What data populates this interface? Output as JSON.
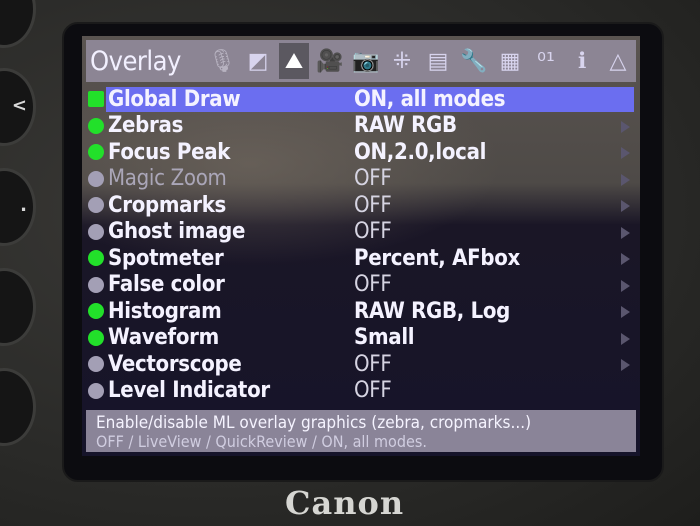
{
  "menu": {
    "title": "Overlay",
    "tabs": [
      {
        "icon": "audio-mic-icon",
        "glyph": "🎙",
        "state": "dim"
      },
      {
        "icon": "exposure-icon",
        "glyph": "◩",
        "state": "normal"
      },
      {
        "icon": "histogram-overlay-icon",
        "glyph": "⛰",
        "state": "active"
      },
      {
        "icon": "movie-camera-icon",
        "glyph": "🎥",
        "state": "normal"
      },
      {
        "icon": "photo-camera-icon",
        "glyph": "📷",
        "state": "normal"
      },
      {
        "icon": "focus-points-icon",
        "glyph": "⁜",
        "state": "normal"
      },
      {
        "icon": "display-settings-icon",
        "glyph": "▤",
        "state": "normal"
      },
      {
        "icon": "wrench-icon",
        "glyph": "🔧",
        "state": "normal"
      },
      {
        "icon": "modules-icon",
        "glyph": "▦",
        "state": "normal"
      },
      {
        "icon": "debug-binary-icon",
        "glyph": "⁰¹",
        "state": "normal"
      },
      {
        "icon": "info-icon",
        "glyph": "ℹ",
        "state": "normal"
      },
      {
        "icon": "delta-icon",
        "glyph": "△",
        "state": "normal"
      }
    ],
    "items": [
      {
        "label": "Global Draw",
        "value": "ON, all modes",
        "enabled": true,
        "selected": true,
        "dim": false,
        "indicator": "square"
      },
      {
        "label": "Zebras",
        "value": "RAW RGB",
        "enabled": true,
        "selected": false,
        "dim": false,
        "indicator": "round"
      },
      {
        "label": "Focus Peak",
        "value": "ON,2.0,local",
        "enabled": true,
        "selected": false,
        "dim": false,
        "indicator": "round"
      },
      {
        "label": "Magic Zoom",
        "value": "OFF",
        "enabled": false,
        "selected": false,
        "dim": true,
        "indicator": "round"
      },
      {
        "label": "Cropmarks",
        "value": "OFF",
        "enabled": false,
        "selected": false,
        "dim": false,
        "indicator": "round"
      },
      {
        "label": "Ghost image",
        "value": "OFF",
        "enabled": false,
        "selected": false,
        "dim": false,
        "indicator": "round"
      },
      {
        "label": "Spotmeter",
        "value": "Percent, AFbox",
        "enabled": true,
        "selected": false,
        "dim": false,
        "indicator": "round"
      },
      {
        "label": "False color",
        "value": "OFF",
        "enabled": false,
        "selected": false,
        "dim": false,
        "indicator": "round"
      },
      {
        "label": "Histogram",
        "value": "RAW RGB, Log",
        "enabled": true,
        "selected": false,
        "dim": false,
        "indicator": "round"
      },
      {
        "label": "Waveform",
        "value": "Small",
        "enabled": true,
        "selected": false,
        "dim": false,
        "indicator": "round"
      },
      {
        "label": "Vectorscope",
        "value": "OFF",
        "enabled": false,
        "selected": false,
        "dim": false,
        "indicator": "round"
      },
      {
        "label": "Level Indicator",
        "value": "OFF",
        "enabled": false,
        "selected": false,
        "dim": false,
        "indicator": "round"
      }
    ],
    "help": {
      "line1": "Enable/disable ML overlay graphics (zebra, cropmarks...)",
      "line2": "OFF / LiveView / QuickReview / ON, all modes."
    }
  },
  "camera": {
    "brand": "Canon"
  },
  "colors": {
    "selection": "#6b6ef0",
    "enabled_indicator": "#22e02a",
    "disabled_indicator": "#a39fb5"
  }
}
